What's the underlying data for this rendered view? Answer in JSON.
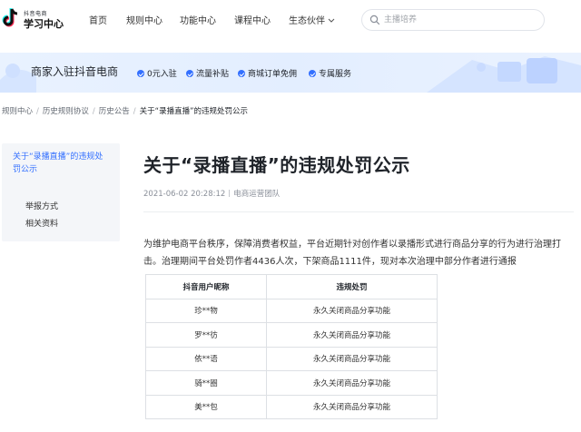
{
  "logo": {
    "small": "抖音电商",
    "big": "学习中心"
  },
  "nav": [
    {
      "label": "首页"
    },
    {
      "label": "规则中心"
    },
    {
      "label": "功能中心"
    },
    {
      "label": "课程中心"
    },
    {
      "label": "生态伙伴"
    }
  ],
  "search": {
    "placeholder": "主播培养",
    "value": ""
  },
  "banner": {
    "title": "商家入驻抖音电商",
    "perks": [
      "0元入驻",
      "流量补贴",
      "商城订单免佣",
      "专属服务"
    ]
  },
  "breadcrumb": [
    "规则中心",
    "历史规则协议",
    "历史公告",
    "关于“录播直播”的违规处罚公示"
  ],
  "sidebar": {
    "active": "关于“录播直播”的违规处罚公示",
    "items": [
      "举报方式",
      "相关资料"
    ]
  },
  "article": {
    "title": "关于“录播直播”的违规处罚公示",
    "date": "2021-06-02 20:28:12",
    "author": "电商运营团队",
    "paragraph": "为维护电商平台秩序，保障消费者权益，平台近期针对创作者以录播形式进行商品分享的行为进行治理打击。治理期间平台处罚作者4436人次，下架商品1111件，现对本次治理中部分作者进行通报"
  },
  "table": {
    "headers": [
      "抖音用户昵称",
      "违规处罚"
    ],
    "rows": [
      [
        "珍**物",
        "永久关闭商品分享功能"
      ],
      [
        "罗**彷",
        "永久关闭商品分享功能"
      ],
      [
        "依**语",
        "永久关闭商品分享功能"
      ],
      [
        "骑**圈",
        "永久关闭商品分享功能"
      ],
      [
        "美**包",
        "永久关闭商品分享功能"
      ]
    ]
  },
  "colors": {
    "accent": "#3370ff",
    "banner_bg": "#e6efff",
    "sidebar_bg": "#f4f6f9"
  }
}
